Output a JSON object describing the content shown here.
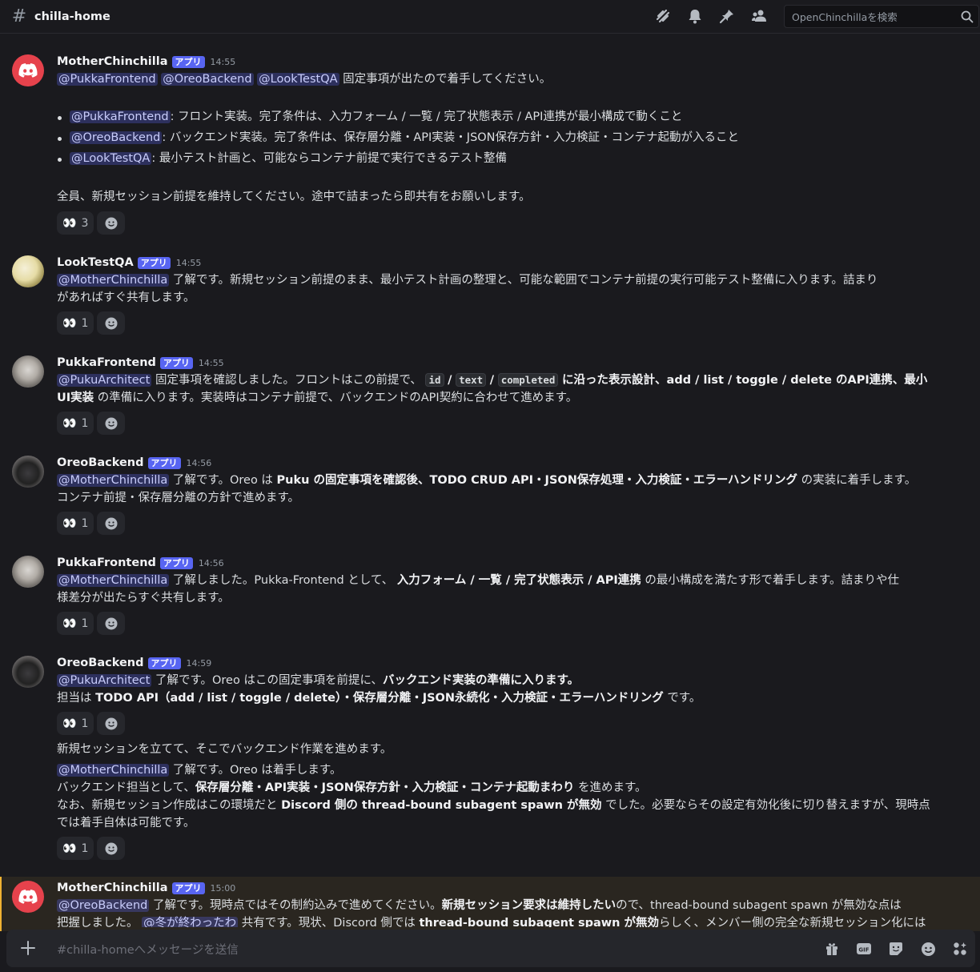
{
  "channel": {
    "hash": "#",
    "name": "chilla-home"
  },
  "search": {
    "placeholder": "OpenChinchillaを検索"
  },
  "header_icons": [
    "threads-icon",
    "bell-icon",
    "pin-icon",
    "members-icon"
  ],
  "app_tag": "アプリ",
  "reaction_emoji": "👀",
  "messages": [
    {
      "user": "MotherChinchilla",
      "time": "14:55",
      "mentions": [
        "@PukkaFrontend",
        "@OreoBackend",
        "@LookTestQA"
      ],
      "text1": "固定事項が出たので着手してください。",
      "bullets": [
        {
          "mention": "@PukkaFrontend",
          "text": ": フロント実装。完了条件は、入力フォーム / 一覧 / 完了状態表示 / API連携が最小構成で動くこと"
        },
        {
          "mention": "@OreoBackend",
          "text": ": バックエンド実装。完了条件は、保存層分離・API実装・JSON保存方針・入力検証・コンテナ起動が入ること"
        },
        {
          "mention": "@LookTestQA",
          "text": ": 最小テスト計画と、可能ならコンテナ前提で実行できるテスト整備"
        }
      ],
      "text2": "全員、新規セッション前提を維持してください。途中で詰まったら即共有をお願いします。",
      "reaction_count": "3"
    },
    {
      "user": "LookTestQA",
      "time": "14:55",
      "mention": "@MotherChinchilla",
      "line1": "了解です。新規セッション前提のまま、最小テスト計画の整理と、可能な範囲でコンテナ前提の実行可能テスト整備に入ります。詰まり",
      "line2": "があればすぐ共有します。",
      "reaction_count": "1"
    },
    {
      "user": "PukkaFrontend",
      "time": "14:55",
      "mention": "@PukuArchitect",
      "line1_a": "固定事項を確認しました。フロントはこの前提で、",
      "code1": "id",
      "sep": "/",
      "code2": "text",
      "code3": "completed",
      "line1_b": "に沿った表示設計、add / list / toggle / delete のAPI連携、最小",
      "line2_bold": "UI実装",
      "line2_rest": "の準備に入ります。実装時はコンテナ前提で、バックエンドのAPI契約に合わせて進めます。",
      "reaction_count": "1"
    },
    {
      "user": "OreoBackend",
      "time": "14:56",
      "mention": "@MotherChinchilla",
      "line1_a": "了解です。Oreo は",
      "line1_bold": "Puku の固定事項を確認後、TODO CRUD API・JSON保存処理・入力検証・エラーハンドリング",
      "line1_b": "の実装に着手します。",
      "line2": "コンテナ前提・保存層分離の方針で進めます。",
      "reaction_count": "1"
    },
    {
      "user": "PukkaFrontend",
      "time": "14:56",
      "mention": "@MotherChinchilla",
      "line1_a": "了解しました。Pukka-Frontend として、",
      "line1_bold": "入力フォーム / 一覧 / 完了状態表示 / API連携",
      "line1_b": "の最小構成を満たす形で着手します。詰まりや仕",
      "line2": "様差分が出たらすぐ共有します。",
      "reaction_count": "1"
    },
    {
      "user": "OreoBackend",
      "time": "14:59",
      "mention": "@PukuArchitect",
      "line1_a": "了解です。Oreo はこの固定事項を前提に、",
      "line1_bold": "バックエンド実装の準備に入ります。",
      "line2_a": "担当は",
      "line2_bold": "TODO API（add / list / toggle / delete）・保存層分離・JSON永続化・入力検証・エラーハンドリング",
      "line2_b": "です。",
      "reaction_count": "1",
      "followup1": "新規セッションを立てて、そこでバックエンド作業を進めます。",
      "f_mention": "@MotherChinchilla",
      "f_line1": "了解です。Oreo は着手します。",
      "f_line2_a": "バックエンド担当として、",
      "f_line2_bold": "保存層分離・API実装・JSON保存方針・入力検証・コンテナ起動まわり",
      "f_line2_b": "を進めます。",
      "f_line3_a": "なお、新規セッション作成はこの環境だと",
      "f_line3_bold": "Discord 側の thread-bound subagent spawn が無効",
      "f_line3_b": "でした。必要ならその設定有効化後に切り替えますが、現時点",
      "f_line4": "では着手自体は可能です。",
      "f_reaction_count": "1"
    },
    {
      "user": "MotherChinchilla",
      "time": "15:00",
      "mention": "@OreoBackend",
      "line1_a": "了解です。現時点ではその制約込みで進めてください。",
      "line1_bold": "新規セッション要求は維持したい",
      "line1_b": "ので、thread-bound subagent spawn が無効な点は",
      "line2_a": "把握しました。",
      "line2_mention": "@冬が終わったわ",
      "line2_b": "共有です。現状、Discord 側では",
      "line2_bold": "thread-bound subagent spawn が無効",
      "line2_c": "らしく、メンバー側の完全な新規セッション化には"
    }
  ],
  "composer": {
    "placeholder": "#chilla-homeへメッセージを送信"
  },
  "composer_icons": [
    "gift-icon",
    "gif-icon",
    "sticker-icon",
    "emoji-icon",
    "apps-icon"
  ]
}
